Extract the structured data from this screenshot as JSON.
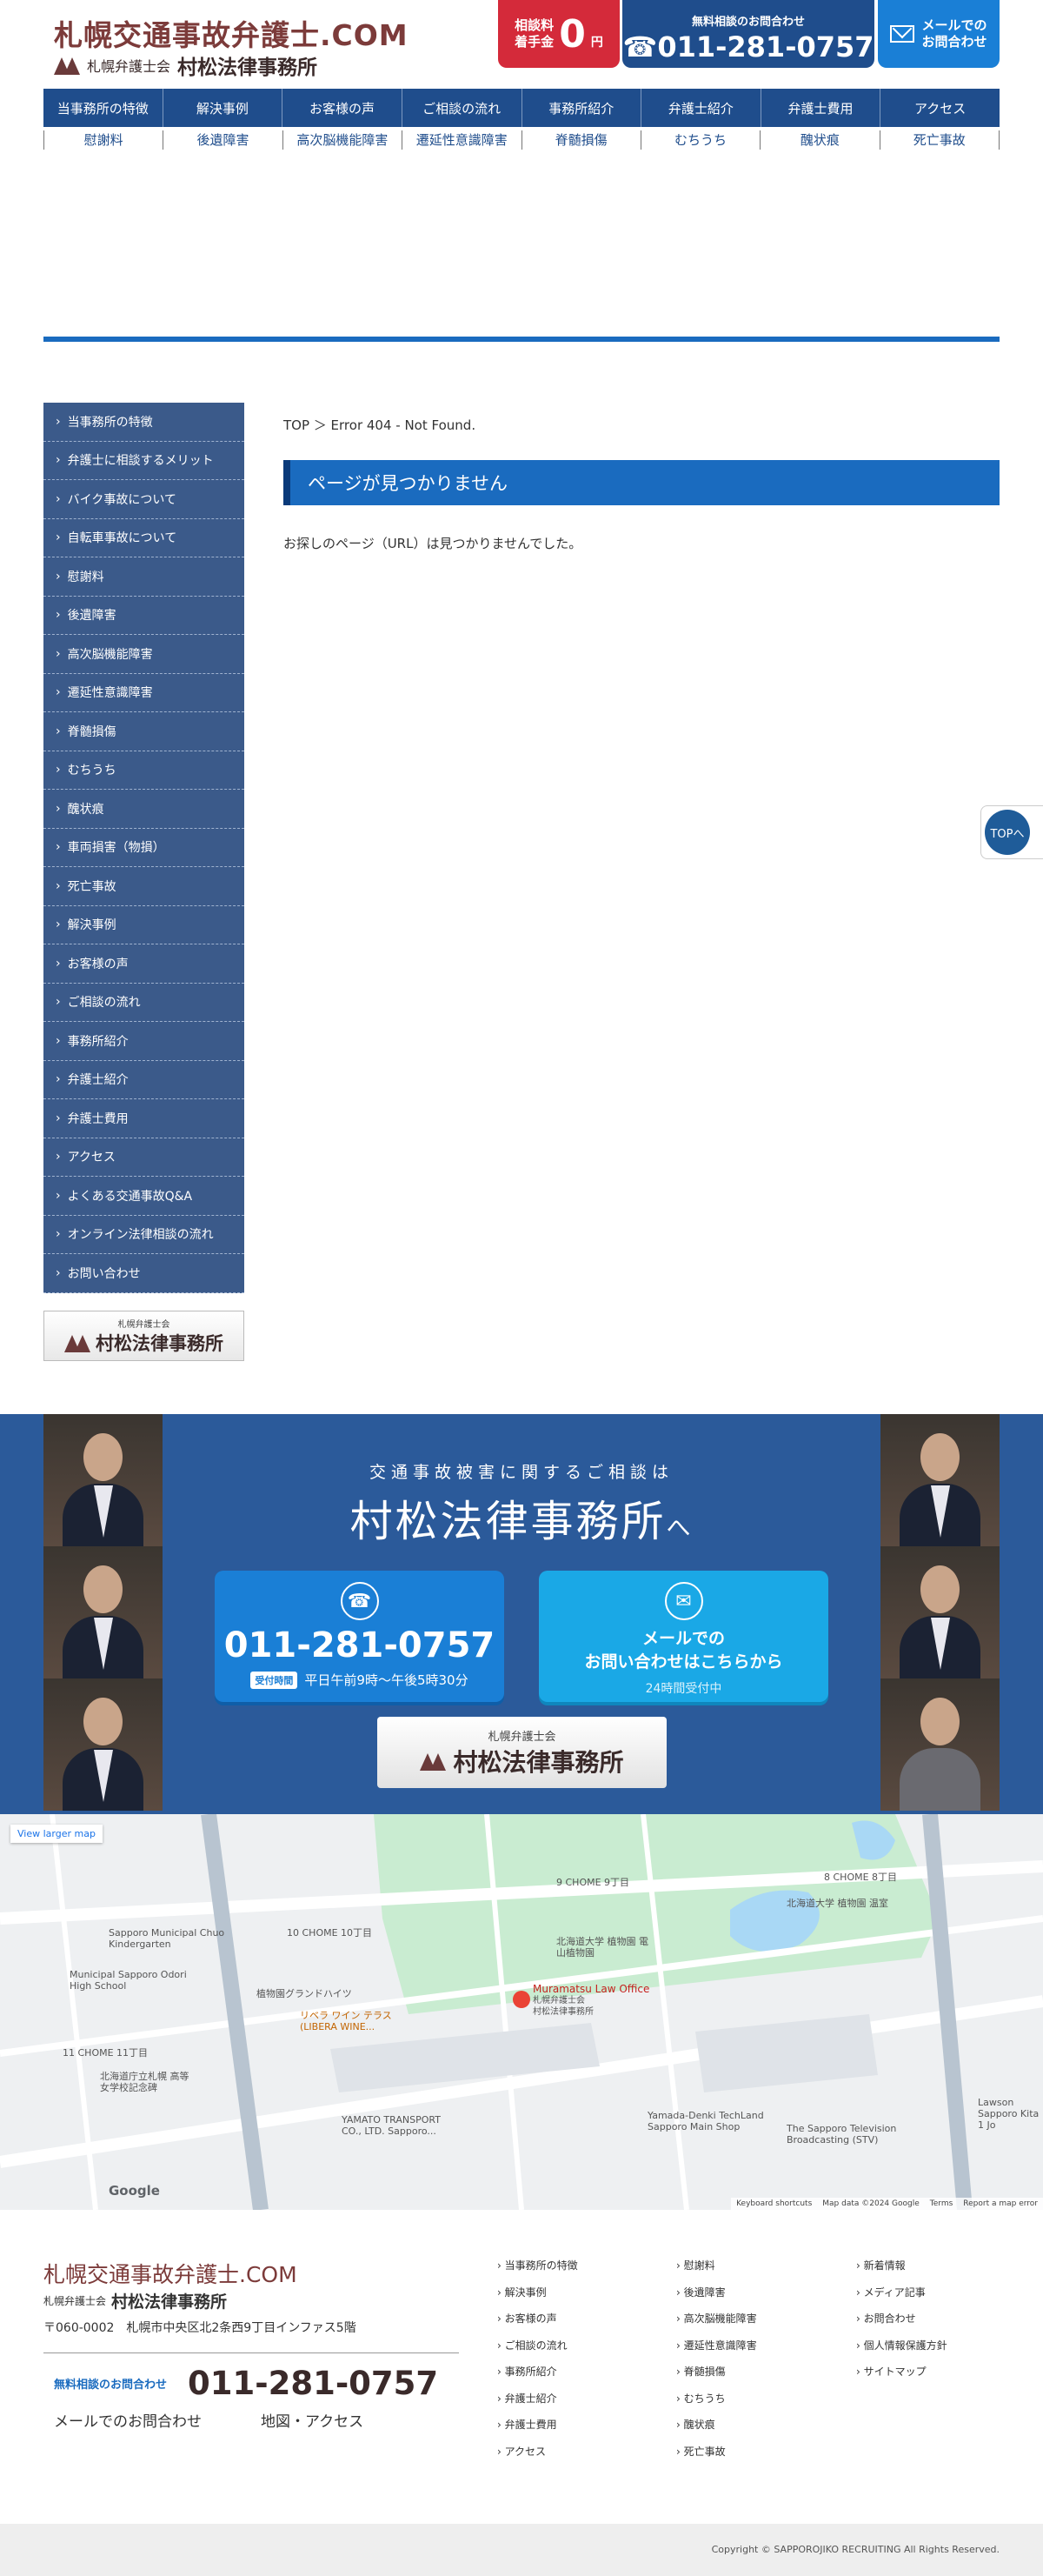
{
  "header": {
    "site_title": "札幌交通事故弁護士.COM",
    "assoc": "札幌弁護士会",
    "firm_name": "村松法律事務所",
    "fee_line1": "相談料",
    "fee_line2": "着手金",
    "fee_zero": "0",
    "fee_unit": "円",
    "phone_label": "無料相談のお問合わせ",
    "phone_number": "☎011-281-0757",
    "mail_line1": "メールでの",
    "mail_line2": "お問合わせ"
  },
  "global_nav": [
    "当事務所の特徴",
    "解決事例",
    "お客様の声",
    "ご相談の流れ",
    "事務所紹介",
    "弁護士紹介",
    "弁護士費用",
    "アクセス"
  ],
  "sub_nav": [
    "慰謝料",
    "後遺障害",
    "高次脳機能障害",
    "遷延性意識障害",
    "脊髄損傷",
    "むちうち",
    "醜状痕",
    "死亡事故"
  ],
  "sidebar": [
    "当事務所の特徴",
    "弁護士に相談するメリット",
    "バイク事故について",
    "自転車事故について",
    "慰謝料",
    "後遺障害",
    "高次脳機能障害",
    "遷延性意識障害",
    "脊髄損傷",
    "むちうち",
    "醜状痕",
    "車両損害（物損）",
    "死亡事故",
    "解決事例",
    "お客様の声",
    "ご相談の流れ",
    "事務所紹介",
    "弁護士紹介",
    "弁護士費用",
    "アクセス",
    "よくある交通事故Q&A",
    "オンライン法律相談の流れ",
    "お問い合わせ"
  ],
  "main": {
    "breadcrumb": "TOP ＞ Error 404 - Not Found.",
    "heading": "ページが見つかりません",
    "message": "お探しのページ（URL）は見つかりませんでした。"
  },
  "to_top": "TOPへ",
  "cta": {
    "lead": "交通事故被害に関するご相談は",
    "title": "村松法律事務所",
    "title_suffix": "へ",
    "tel": "011-281-0757",
    "hours_badge": "受付時間",
    "hours": "平日午前9時〜午後5時30分",
    "mail_line1": "メールでの",
    "mail_line2": "お問い合わせはこちらから",
    "mail_sub": "24時間受付中"
  },
  "map": {
    "larger": "View larger map",
    "pin_name": "Muramatsu Law Office",
    "pin_sub": "札幌弁護士会\n村松法律事務所",
    "labels": [
      "9 CHOME 9丁目",
      "8 CHOME 8丁目",
      "北海道大学 植物園 温室",
      "10 CHOME 10丁目",
      "Sapporo Municipal Chuo Kindergarten",
      "Municipal Sapporo Odori High School",
      "植物園グランドハイツ",
      "リベラ ワイン テラス(LIBERA WINE...",
      "北海道大学 植物園 電山植物園",
      "11 CHOME 11丁目",
      "北海道庁立札幌 高等女学校記念碑",
      "YAMATO TRANSPORT CO., LTD. Sapporo...",
      "Yamada-Denki TechLand Sapporo Main Shop",
      "The Sapporo Television Broadcasting (STV)",
      "Lawson Sapporo Kita 1 Jo"
    ],
    "foot": [
      "Keyboard shortcuts",
      "Map data ©2024 Google",
      "Terms",
      "Report a map error"
    ],
    "google": "Google"
  },
  "footer": {
    "title": "札幌交通事故弁護士.COM",
    "assoc": "札幌弁護士会",
    "firm": "村松法律事務所",
    "address": "〒060-0002　札幌市中央区北2条西9丁目インファス5階",
    "tel_label": "無料相談のお問合わせ",
    "tel": "011-281-0757",
    "mail_link": "メールでのお問合わせ",
    "map_link": "地図・アクセス",
    "col1": [
      "当事務所の特徴",
      "解決事例",
      "お客様の声",
      "ご相談の流れ",
      "事務所紹介",
      "弁護士紹介",
      "弁護士費用",
      "アクセス"
    ],
    "col2": [
      "慰謝料",
      "後遺障害",
      "高次脳機能障害",
      "遷延性意識障害",
      "脊髄損傷",
      "むちうち",
      "醜状痕",
      "死亡事故"
    ],
    "col3": [
      "新着情報",
      "メディア記事",
      "お問合わせ",
      "個人情報保護方針",
      "サイトマップ"
    ],
    "copyright": "Copyright © SAPPOROJIKO RECRUITING All Rights Reserved."
  }
}
